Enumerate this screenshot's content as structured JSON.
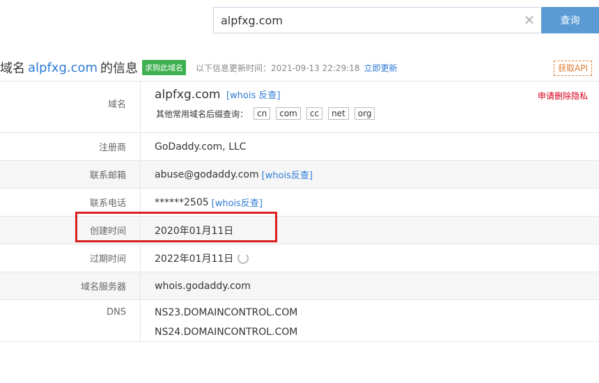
{
  "search": {
    "value": "alpfxg.com",
    "clear_icon": "close-icon",
    "button_label": "查询"
  },
  "heading": {
    "prefix": "域名",
    "domain": "alpfxg.com",
    "suffix": "的信息",
    "buy_badge": "求购此域名",
    "update_text": "以下信息更新时间：2021-09-13 22:29:18",
    "update_link": "立即更新",
    "api_button": "获取API"
  },
  "rows": {
    "domain": {
      "label": "域名",
      "value": "alpfxg.com",
      "whois_link": "[whois 反查]",
      "privacy_link": "申请删除隐私",
      "suffix_label": "其他常用域名后缀查询：",
      "suffixes": [
        "cn",
        "com",
        "cc",
        "net",
        "org"
      ]
    },
    "registrar": {
      "label": "注册商",
      "value": "GoDaddy.com, LLC"
    },
    "email": {
      "label": "联系邮箱",
      "value": "abuse@godaddy.com",
      "link": "[whois反查]"
    },
    "phone": {
      "label": "联系电话",
      "value": "******2505",
      "link": "[whois反查]"
    },
    "created": {
      "label": "创建时间",
      "value": "2020年01月11日"
    },
    "expires": {
      "label": "过期时间",
      "value": "2022年01月11日",
      "icon": "loading-icon"
    },
    "nameserver": {
      "label": "域名服务器",
      "value": "whois.godaddy.com"
    },
    "dns": {
      "label": "DNS",
      "values": [
        "NS23.DOMAINCONTROL.COM",
        "NS24.DOMAINCONTROL.COM"
      ]
    }
  },
  "colors": {
    "accent": "#2c7bd6",
    "search_button": "#5b9bd5",
    "buy_badge": "#3fb050",
    "api_border": "#e07b32",
    "privacy": "#d9001b",
    "highlight": "#d81e1e"
  }
}
